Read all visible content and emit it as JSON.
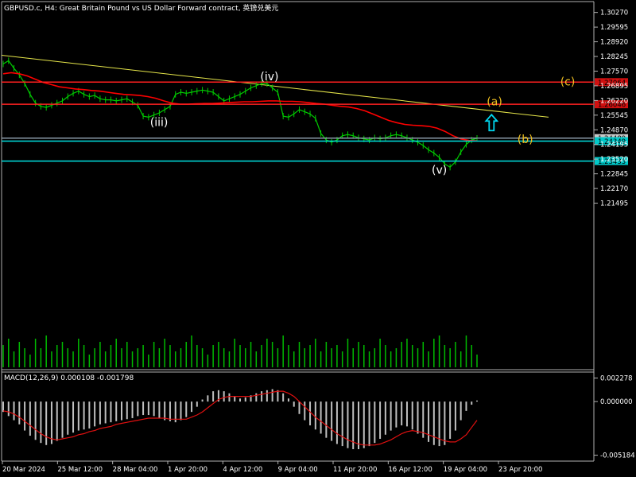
{
  "window": {
    "title": "GBPUSD.c, H4:  Great Britain Pound vs US Dollar Forward contract, 英镑兑美元"
  },
  "chart_data": [
    {
      "type": "line",
      "title": "GBPUSD.c, H4:  Great Britain Pound vs US Dollar Forward contract, 英镑兑美元",
      "ylim": [
        1.142,
        1.3055
      ],
      "y_ticks": [
        "1.30270",
        "1.29595",
        "1.28920",
        "1.28245",
        "1.27570",
        "1.26895",
        "1.26220",
        "1.25545",
        "1.24870",
        "1.24195",
        "1.23520",
        "1.22845",
        "1.22170",
        "1.21495"
      ],
      "x_ticks": [
        "20 Mar 2024",
        "25 Mar 12:00",
        "28 Mar 04:00",
        "1 Apr 20:00",
        "4 Apr 12:00",
        "9 Apr 04:00",
        "11 Apr 20:00",
        "16 Apr 12:00",
        "19 Apr 04:00",
        "23 Apr 20:00"
      ],
      "grid": false,
      "series": [
        {
          "kind": "price",
          "color": "#00cc00",
          "values": [
            1.279,
            1.2805,
            1.277,
            1.274,
            1.27,
            1.265,
            1.261,
            1.2595,
            1.259,
            1.26,
            1.261,
            1.262,
            1.264,
            1.2655,
            1.2665,
            1.265,
            1.264,
            1.2645,
            1.263,
            1.2625,
            1.2625,
            1.262,
            1.2625,
            1.263,
            1.2615,
            1.26,
            1.255,
            1.2545,
            1.2555,
            1.2565,
            1.258,
            1.2595,
            1.265,
            1.266,
            1.2655,
            1.266,
            1.2665,
            1.267,
            1.2665,
            1.266,
            1.264,
            1.262,
            1.263,
            1.264,
            1.265,
            1.2665,
            1.268,
            1.269,
            1.27,
            1.27,
            1.268,
            1.266,
            1.255,
            1.2545,
            1.256,
            1.258,
            1.257,
            1.256,
            1.254,
            1.247,
            1.244,
            1.243,
            1.244,
            1.246,
            1.2465,
            1.246,
            1.245,
            1.2445,
            1.244,
            1.245,
            1.2445,
            1.245,
            1.246,
            1.2465,
            1.246,
            1.245,
            1.244,
            1.243,
            1.2415,
            1.2395,
            1.238,
            1.236,
            1.233,
            1.2315,
            1.234,
            1.2385,
            1.242,
            1.244,
            1.2448
          ]
        },
        {
          "kind": "moving-average",
          "color": "#ff0000",
          "values": [
            1.2745,
            1.275,
            1.2745,
            1.2735,
            1.272,
            1.2705,
            1.2695,
            1.2685,
            1.268,
            1.2675,
            1.2672,
            1.2668,
            1.2665,
            1.266,
            1.2655,
            1.265,
            1.2648,
            1.2645,
            1.264,
            1.2632,
            1.262,
            1.261,
            1.2605,
            1.2605,
            1.2607,
            1.2608,
            1.2608,
            1.261,
            1.2612,
            1.2614,
            1.2616,
            1.2616,
            1.2618,
            1.262,
            1.262,
            1.2618,
            1.2618,
            1.2616,
            1.2612,
            1.2608,
            1.2605,
            1.26,
            1.2595,
            1.2592,
            1.2585,
            1.2575,
            1.256,
            1.2545,
            1.253,
            1.252,
            1.2512,
            1.2508,
            1.2506,
            1.2503,
            1.2495,
            1.248,
            1.246,
            1.2445,
            1.2438,
            1.2436
          ]
        }
      ],
      "horizontal_levels": [
        {
          "value": "1.27064",
          "y": 1.27064,
          "color": "#ff2020",
          "label_bg": "#d01010"
        },
        {
          "value": "1.26046",
          "y": 1.26046,
          "color": "#ff2020",
          "label_bg": "#d01010"
        },
        {
          "value": "1.24489",
          "y": 1.24489,
          "color": "#8a9aa8",
          "label_bg": "#c8c8c8"
        },
        {
          "value": "1.24349",
          "y": 1.24349,
          "color": "#00e0e0",
          "label_bg": "#00c8c8"
        },
        {
          "value": "1.23433",
          "y": 1.23433,
          "color": "#00e0e0",
          "label_bg": "#00c8c8"
        }
      ],
      "trendline": {
        "from": 1.283,
        "to": 1.2545,
        "color": "#e6e64a"
      },
      "annotations": [
        {
          "text": "(iii)",
          "color": "#ffffff",
          "price": 1.252,
          "at": 0.24
        },
        {
          "text": "(iv)",
          "color": "#ffffff",
          "price": 1.273,
          "at": 0.42
        },
        {
          "text": "(v)",
          "color": "#ffffff",
          "price": 1.23,
          "at": 0.7
        },
        {
          "text": "(a)",
          "color": "#f0c020",
          "price": 1.2615,
          "at": 0.79
        },
        {
          "text": "(b)",
          "color": "#f0c020",
          "price": 1.244,
          "at": 0.84
        },
        {
          "text": "(c)",
          "color": "#f0c020",
          "price": 1.2706,
          "at": 0.91
        }
      ],
      "arrow": {
        "direction": "up",
        "color": "#00d8f0",
        "price": 1.252,
        "at": 0.79
      },
      "volume": {
        "color": "#00bb00",
        "values": [
          7,
          9,
          5,
          8,
          6,
          4,
          9,
          6,
          10,
          5,
          7,
          8,
          6,
          5,
          9,
          7,
          4,
          6,
          8,
          5,
          7,
          9,
          6,
          8,
          5,
          6,
          7,
          4,
          8,
          6,
          9,
          7,
          5,
          6,
          8,
          10,
          7,
          6,
          4,
          7,
          8,
          6,
          5,
          9,
          7,
          6,
          8,
          5,
          7,
          9,
          8,
          6,
          10,
          7,
          5,
          8,
          6,
          7,
          9,
          5,
          8,
          6,
          7,
          5,
          9,
          6,
          8,
          7,
          5,
          6,
          9,
          7,
          5,
          6,
          8,
          9,
          7,
          6,
          8,
          5,
          9,
          10,
          7,
          6,
          8,
          5,
          10,
          7,
          4
        ]
      }
    },
    {
      "type": "bar",
      "title": "MACD(12,26,9) 0.000108 -0.001798",
      "ylim": [
        -0.0056,
        0.0027
      ],
      "y_ticks": [
        "0.002278",
        "0.000000",
        "-0.005184"
      ],
      "series": [
        {
          "name": "MACD",
          "kind": "histogram",
          "color": "#c0c0c0",
          "values": [
            -0.001,
            -0.0014,
            -0.0018,
            -0.0022,
            -0.0028,
            -0.0033,
            -0.0037,
            -0.004,
            -0.0042,
            -0.0041,
            -0.0038,
            -0.0035,
            -0.0032,
            -0.003,
            -0.0028,
            -0.0027,
            -0.0026,
            -0.0024,
            -0.0022,
            -0.0021,
            -0.002,
            -0.0019,
            -0.0018,
            -0.0017,
            -0.0016,
            -0.0014,
            -0.0013,
            -0.0013,
            -0.0014,
            -0.0016,
            -0.0018,
            -0.0019,
            -0.002,
            -0.0018,
            -0.0015,
            -0.001,
            -0.0005,
            0.0002,
            0.0006,
            0.001,
            0.0011,
            0.001,
            0.0008,
            0.0005,
            0.0003,
            0.0004,
            0.0006,
            0.0008,
            0.001,
            0.0011,
            0.0012,
            0.0011,
            0.0008,
            0.0003,
            -0.0005,
            -0.0012,
            -0.0018,
            -0.0023,
            -0.0027,
            -0.0031,
            -0.0035,
            -0.0038,
            -0.0041,
            -0.0043,
            -0.0045,
            -0.0046,
            -0.0046,
            -0.0045,
            -0.0043,
            -0.004,
            -0.0036,
            -0.0032,
            -0.0028,
            -0.0025,
            -0.0023,
            -0.0024,
            -0.0027,
            -0.0031,
            -0.0035,
            -0.0039,
            -0.0042,
            -0.0043,
            -0.0042,
            -0.0036,
            -0.0028,
            -0.0018,
            -0.0009,
            -0.0003,
            0.0001
          ]
        },
        {
          "name": "Signal",
          "kind": "signal-line",
          "color": "#e01010",
          "values": [
            -0.0009,
            -0.001,
            -0.0012,
            -0.0015,
            -0.0019,
            -0.0023,
            -0.0027,
            -0.0031,
            -0.0034,
            -0.0036,
            -0.0037,
            -0.0036,
            -0.0035,
            -0.0034,
            -0.0032,
            -0.0031,
            -0.0029,
            -0.0028,
            -0.0026,
            -0.0025,
            -0.0024,
            -0.0022,
            -0.0021,
            -0.002,
            -0.0019,
            -0.0018,
            -0.0017,
            -0.0016,
            -0.0016,
            -0.0016,
            -0.0016,
            -0.0017,
            -0.0017,
            -0.0017,
            -0.0017,
            -0.0015,
            -0.0013,
            -0.001,
            -0.0006,
            -0.0002,
            0.0002,
            0.0004,
            0.0005,
            0.0005,
            0.0005,
            0.0005,
            0.0005,
            0.0006,
            0.0007,
            0.0008,
            0.0009,
            0.001,
            0.001,
            0.0008,
            0.0005,
            0.0,
            -0.0005,
            -0.001,
            -0.0015,
            -0.0019,
            -0.0023,
            -0.0027,
            -0.0031,
            -0.0034,
            -0.0037,
            -0.0039,
            -0.0041,
            -0.0042,
            -0.0042,
            -0.0042,
            -0.0041,
            -0.0039,
            -0.0037,
            -0.0034,
            -0.0031,
            -0.0029,
            -0.0028,
            -0.0029,
            -0.003,
            -0.0032,
            -0.0034,
            -0.0036,
            -0.0038,
            -0.0039,
            -0.0039,
            -0.0036,
            -0.0032,
            -0.0025,
            -0.0018
          ]
        }
      ]
    }
  ]
}
